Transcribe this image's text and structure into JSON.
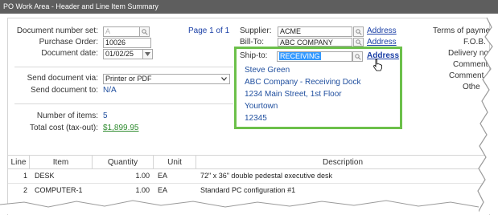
{
  "window": {
    "title": "PO Work Area - Header and Line Item Summary"
  },
  "header": {
    "doc_number_label": "Document number set:",
    "doc_number_value": "A",
    "page_info": "Page 1 of 1",
    "po_label": "Purchase Order:",
    "po_value": "10026",
    "doc_date_label": "Document date:",
    "doc_date_value": "01/02/25",
    "send_via_label": "Send document via:",
    "send_via_value": "Printer or PDF",
    "send_to_label": "Send document to:",
    "send_to_value": "N/A",
    "num_items_label": "Number of items:",
    "num_items_value": "5",
    "total_cost_label": "Total cost (tax-out):",
    "total_cost_value": "$1,899.95"
  },
  "supplier": {
    "supplier_label": "Supplier:",
    "supplier_value": "ACME",
    "supplier_address": "Address",
    "billto_label": "Bill-To:",
    "billto_value": "ABC COMPANY",
    "billto_address": "Address",
    "shipto_label": "Ship-to:",
    "shipto_value": "RECEIVING",
    "shipto_address": "Address",
    "shipto_lines": [
      "Steve Green",
      "ABC Company - Receiving Dock",
      "1234 Main Street, 1st Floor",
      "Yourtown",
      "12345"
    ]
  },
  "terms": {
    "terms_label": "Terms of payme",
    "fob_label": "F.O.B.",
    "delivery_label": "Delivery no",
    "comment1_label": "Comment",
    "comment2_label": "Comment",
    "other_label": "Othe"
  },
  "table": {
    "columns": [
      "Line",
      "Item",
      "Quantity",
      "Unit",
      "Description"
    ],
    "rows": [
      {
        "line": "1",
        "item": "DESK",
        "quantity": "1.00",
        "unit": "EA",
        "description": "72\" x 36\" double pedestal executive desk"
      },
      {
        "line": "2",
        "item": "COMPUTER-1",
        "quantity": "1.00",
        "unit": "EA",
        "description": "Standard PC configuration #1"
      }
    ]
  },
  "colors": {
    "titlebar": "#5e5e5e",
    "link": "#1a3fa6",
    "highlight_border": "#6cc04a",
    "selection": "#3399ff"
  },
  "icons": {
    "lookup": "magnifier-icon",
    "calendar": "dropdown-arrow-icon",
    "cursor": "hand-cursor-icon"
  }
}
